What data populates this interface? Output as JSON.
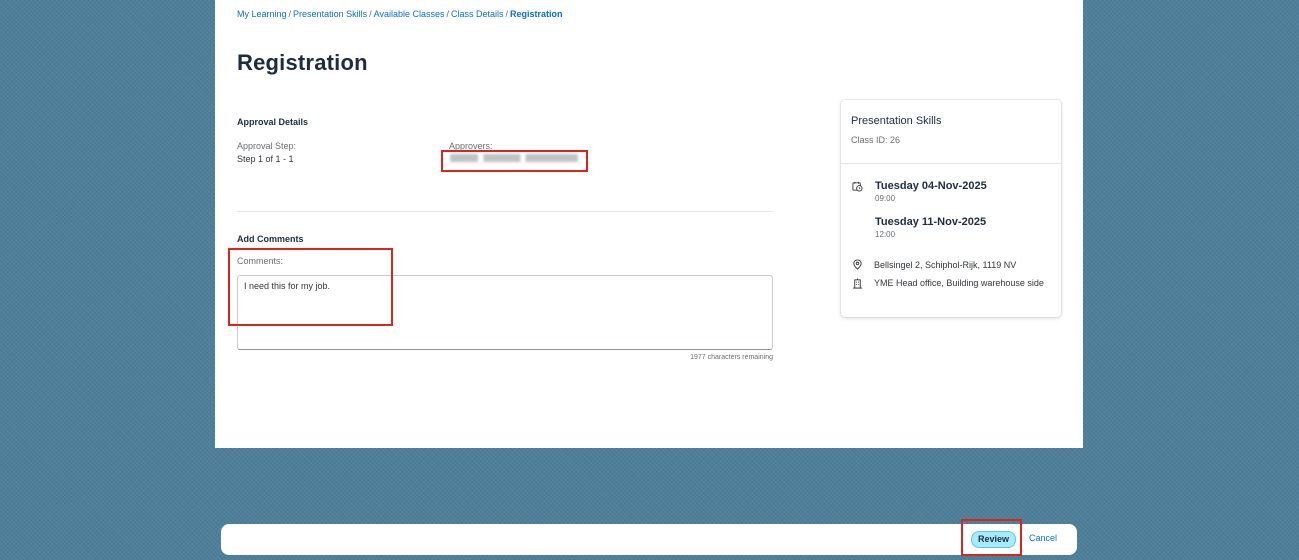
{
  "breadcrumb": {
    "items": [
      "My Learning",
      "Presentation Skills",
      "Available Classes",
      "Class Details"
    ],
    "current": "Registration"
  },
  "page": {
    "title": "Registration"
  },
  "approval": {
    "section_title": "Approval Details",
    "step_label": "Approval Step:",
    "step_value": "Step 1 of 1 - 1",
    "approvers_label": "Approvers:"
  },
  "comments": {
    "section_title": "Add Comments",
    "label": "Comments:",
    "value": "I need this for my job.",
    "remaining": "1977 characters remaining"
  },
  "class_card": {
    "title": "Presentation Skills",
    "class_id": "Class ID: 26",
    "start_date": "Tuesday 04-Nov-2025",
    "start_time": "09:00",
    "end_date": "Tuesday 11-Nov-2025",
    "end_time": "12:00",
    "address": "Bellsingel 2, Schiphol-Rijk, 1119 NV",
    "facility": "YME Head office, Building warehouse side"
  },
  "footer": {
    "review_label": "Review",
    "cancel_label": "Cancel"
  },
  "icons": {
    "calendar": "calendar-clock-icon",
    "location": "location-pin-icon",
    "building": "building-icon"
  },
  "colors": {
    "link": "#0a6ed1",
    "review_button": "#a6ebfb",
    "highlight": "#d9251d",
    "background": "#4e7f9a"
  }
}
